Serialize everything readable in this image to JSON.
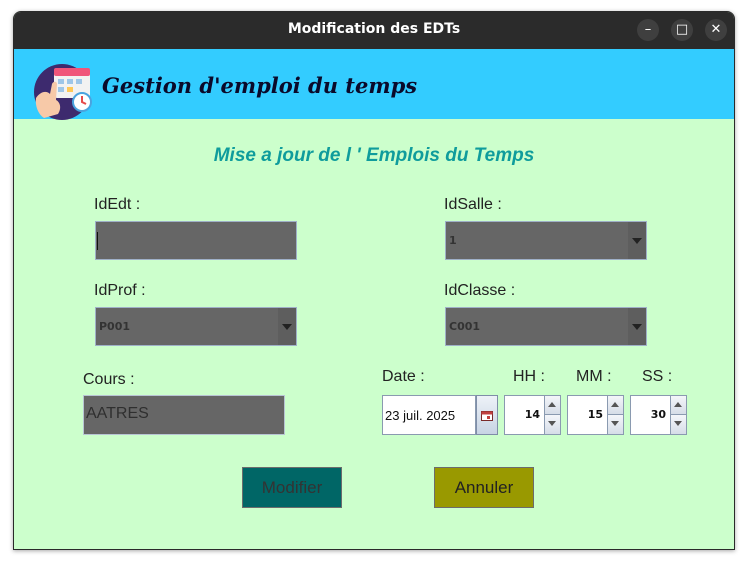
{
  "window": {
    "title": "Modification des EDTs",
    "controls": {
      "minimize": "–",
      "maximize": "□",
      "close": "✕"
    }
  },
  "header": {
    "app_title": "Gestion d'emploi du temps",
    "logo_icon": "calendar-hand-icon"
  },
  "form": {
    "title": "Mise a jour de l ' Emplois du Temps",
    "idedt": {
      "label": "IdEdt :",
      "value": ""
    },
    "idsalle": {
      "label": "IdSalle :",
      "value": "1"
    },
    "idprof": {
      "label": "IdProf :",
      "value": "P001"
    },
    "idclasse": {
      "label": "IdClasse :",
      "value": "C001"
    },
    "cours": {
      "label": "Cours :",
      "value": "AATRES"
    },
    "date": {
      "label": "Date :",
      "value": "23 juil. 2025",
      "calendar_icon": "calendar-icon"
    },
    "hh": {
      "label": "HH :",
      "value": "14"
    },
    "mm": {
      "label": "MM :",
      "value": "15"
    },
    "ss": {
      "label": "SS :",
      "value": "30"
    }
  },
  "buttons": {
    "modifier": "Modifier",
    "annuler": "Annuler"
  },
  "colors": {
    "header_bg": "#33ccff",
    "form_bg": "#ccffcc",
    "title_color": "#0f9c9c",
    "modifier_bg": "#006666",
    "annuler_bg": "#999900",
    "field_bg": "#666666"
  }
}
